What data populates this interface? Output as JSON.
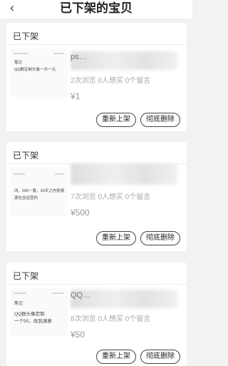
{
  "header": {
    "back_icon": "chevron-left-icon",
    "title": "已下架的宝贝"
  },
  "items": [
    {
      "status": "已下架",
      "thumb_lines": [
        "笔记",
        "QQ群定制头像一次一元"
      ],
      "title_visible": "ps…",
      "stats": "2次浏览 0人想买 0个留言",
      "price": "¥1",
      "relist_label": "重新上架",
      "delete_label": "彻底删除"
    },
    {
      "status": "已下架",
      "thumb_lines": [
        "闭，500一套，30天之内免费",
        "源包含运营的"
      ],
      "title_visible": "",
      "stats": "7次浏览 0人想买 0个留言",
      "price": "¥500",
      "relist_label": "重新上架",
      "delete_label": "彻底删除"
    },
    {
      "status": "已下架",
      "thumb_lines": [
        "笔记",
        "QQ群头像定制",
        "一个50，改到满意"
      ],
      "title_visible": "QQ…",
      "stats": "8次浏览 0人想买 0个留言",
      "price": "¥50",
      "relist_label": "重新上架",
      "delete_label": "彻底删除"
    }
  ]
}
